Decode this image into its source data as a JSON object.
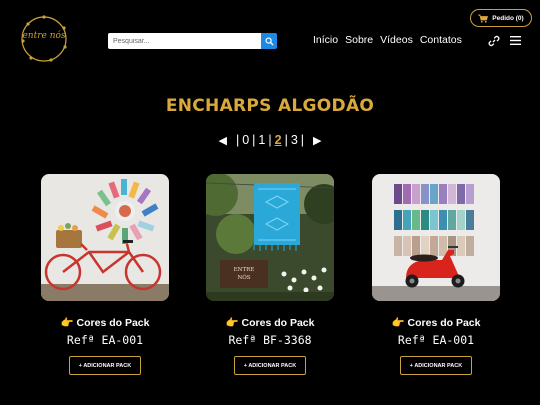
{
  "header": {
    "logo_text": "entre nós",
    "search": {
      "placeholder": "Pesquisar..."
    },
    "nav": [
      "Início",
      "Sobre",
      "Vídeos",
      "Contatos"
    ],
    "order_label": "Pedido (0)"
  },
  "main": {
    "title": "ENCHARPS ALGODÃO",
    "pagination": {
      "pages": [
        "0",
        "1",
        "2",
        "3"
      ],
      "current": "2"
    },
    "products": [
      {
        "caption": "👉 Cores do Pack",
        "ref": "Refª EA-001",
        "button": "+ ADICIONAR PACK"
      },
      {
        "caption": "👉 Cores do Pack",
        "ref": "Refª BF-3368",
        "button": "+ ADICIONAR PACK",
        "sign_text": "ENTRE NÓS"
      },
      {
        "caption": "👉 Cores do Pack",
        "ref": "Refª EA-001",
        "button": "+ ADICIONAR PACK"
      }
    ]
  },
  "colors": {
    "accent": "#d9a93b",
    "search_button": "#1e88e5",
    "background": "#000000"
  }
}
